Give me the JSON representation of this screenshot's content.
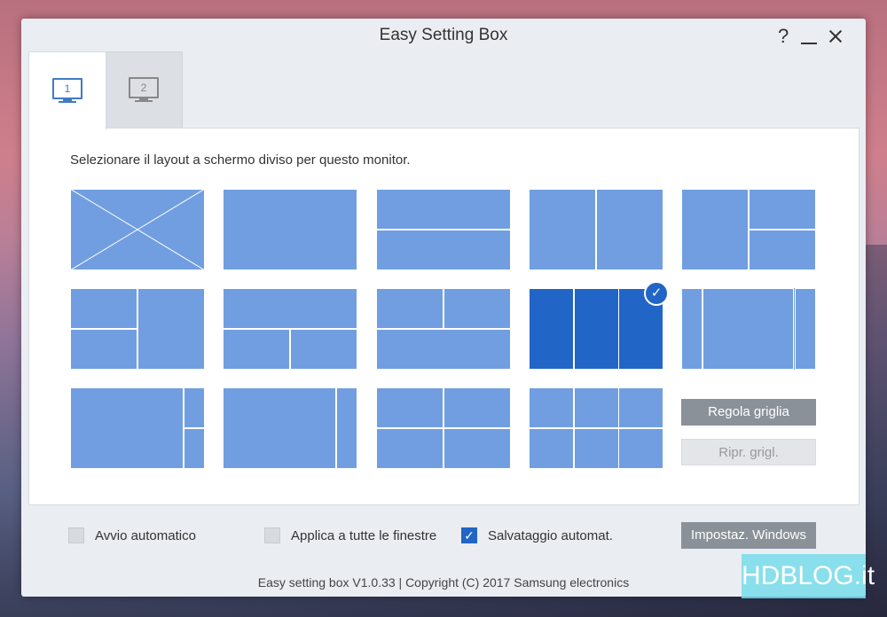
{
  "window": {
    "title": "Easy Setting Box",
    "help_label": "?"
  },
  "tabs": [
    {
      "label": "1",
      "selected": true
    },
    {
      "label": "2",
      "selected": false
    }
  ],
  "main": {
    "instruction": "Selezionare il layout a schermo diviso per questo monitor.",
    "selected_layout_index": 8,
    "check_glyph": "✓",
    "buttons": {
      "regola": "Regola griglia",
      "ripr": "Ripr. grigl."
    }
  },
  "footer": {
    "options": [
      {
        "label": "Avvio automatico",
        "checked": false
      },
      {
        "label": "Applica a tutte le finestre",
        "checked": false
      },
      {
        "label": "Salvataggio automat.",
        "checked": true
      }
    ],
    "windows_button": "Impostaz. Windows",
    "copyright": "Easy setting box V1.0.33 | Copyright (C) 2017 Samsung electronics"
  },
  "watermark": "HDBLOG.it",
  "colors": {
    "layout_fill": "#719ee0",
    "layout_selected": "#2165c7",
    "button_gray": "#8a9199"
  }
}
